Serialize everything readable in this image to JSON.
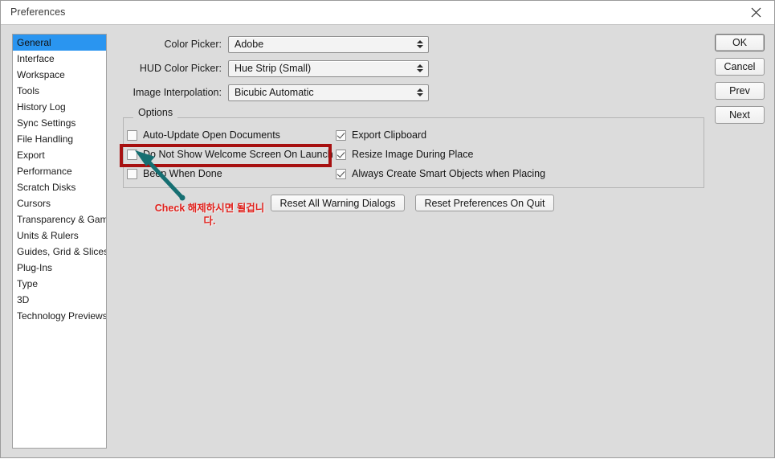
{
  "window": {
    "title": "Preferences",
    "close_icon": "close-icon"
  },
  "sidebar": {
    "items": [
      {
        "label": "General",
        "selected": true
      },
      {
        "label": "Interface",
        "selected": false
      },
      {
        "label": "Workspace",
        "selected": false
      },
      {
        "label": "Tools",
        "selected": false
      },
      {
        "label": "History Log",
        "selected": false
      },
      {
        "label": "Sync Settings",
        "selected": false
      },
      {
        "label": "File Handling",
        "selected": false
      },
      {
        "label": "Export",
        "selected": false
      },
      {
        "label": "Performance",
        "selected": false
      },
      {
        "label": "Scratch Disks",
        "selected": false
      },
      {
        "label": "Cursors",
        "selected": false
      },
      {
        "label": "Transparency & Gamut",
        "selected": false
      },
      {
        "label": "Units & Rulers",
        "selected": false
      },
      {
        "label": "Guides, Grid & Slices",
        "selected": false
      },
      {
        "label": "Plug-Ins",
        "selected": false
      },
      {
        "label": "Type",
        "selected": false
      },
      {
        "label": "3D",
        "selected": false
      },
      {
        "label": "Technology Previews",
        "selected": false
      }
    ]
  },
  "form": {
    "rows": [
      {
        "label": "Color Picker:",
        "value": "Adobe"
      },
      {
        "label": "HUD Color Picker:",
        "value": "Hue Strip (Small)"
      },
      {
        "label": "Image Interpolation:",
        "value": "Bicubic Automatic"
      }
    ]
  },
  "options": {
    "title": "Options",
    "left_column": [
      {
        "label": "Auto-Update Open Documents",
        "checked": false
      },
      {
        "label": "Do Not Show Welcome Screen On Launch",
        "checked": false
      },
      {
        "label": "Beep When Done",
        "checked": false
      }
    ],
    "right_column": [
      {
        "label": "Export Clipboard",
        "checked": true
      },
      {
        "label": "Resize Image During Place",
        "checked": true
      },
      {
        "label": "Always Create Smart Objects when Placing",
        "checked": true
      }
    ]
  },
  "reset_buttons": [
    {
      "label": "Reset All Warning Dialogs"
    },
    {
      "label": "Reset Preferences On Quit"
    }
  ],
  "action_buttons": [
    {
      "label": "OK",
      "primary": true
    },
    {
      "label": "Cancel",
      "primary": false
    },
    {
      "label": "Prev",
      "primary": false
    },
    {
      "label": "Next",
      "primary": false
    }
  ],
  "annotation": {
    "text": "Check 해제하시면 될겁니다.",
    "text_color": "#e0201b",
    "highlight_color": "#a71010",
    "arrow_color": "#166f72"
  }
}
